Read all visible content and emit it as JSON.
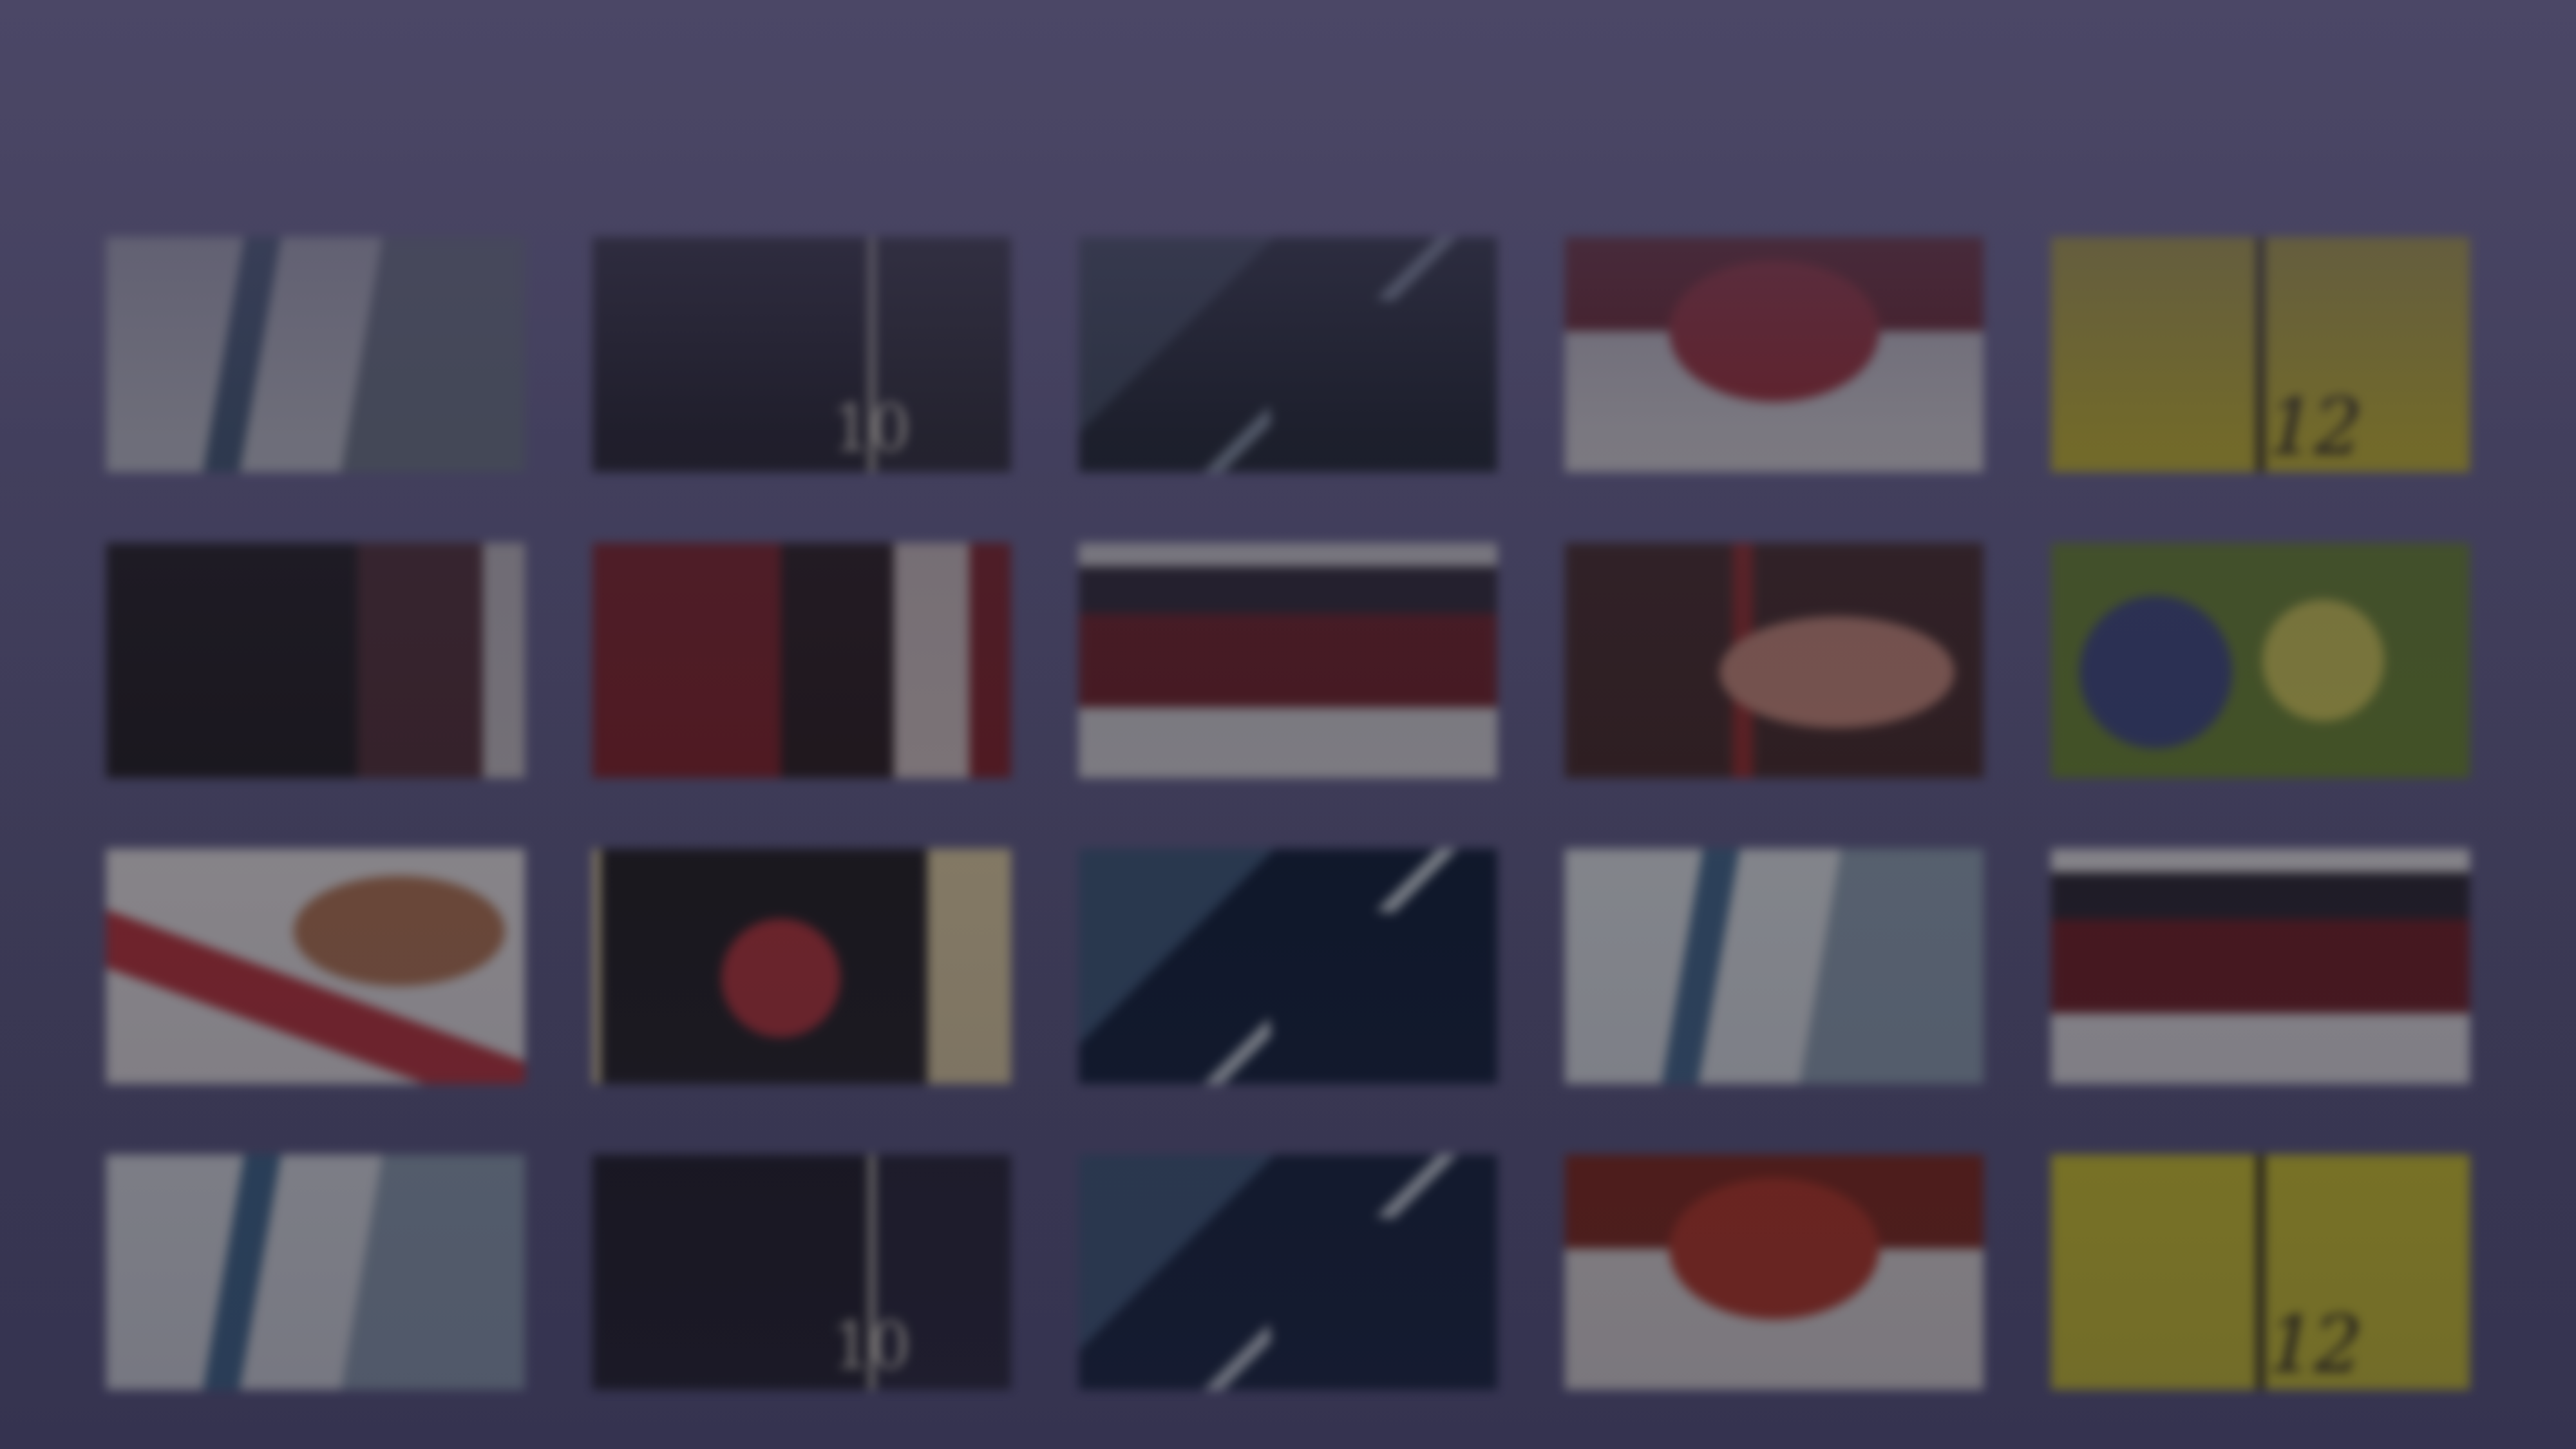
{
  "screen": {
    "title": "",
    "background": "#3b3953"
  },
  "grid": {
    "tiles": [
      {
        "theme": "racing-poster-blue",
        "colors": [
          "#6e7a8c",
          "#c9ccd6",
          "#3e5a7c"
        ],
        "label": ""
      },
      {
        "theme": "dark-poster-number",
        "colors": [
          "#22202e",
          "#2b2937",
          "#d9d3c4"
        ],
        "label": "10"
      },
      {
        "theme": "space-station-dark",
        "colors": [
          "#1a2230",
          "#3b4b60",
          "#8a9cb0"
        ],
        "label": ""
      },
      {
        "theme": "red-figure-poster",
        "colors": [
          "#b8242a",
          "#e5e1e3",
          "#7a1a1e"
        ],
        "label": ""
      },
      {
        "theme": "yellow-poster-number",
        "colors": [
          "#d4c21c",
          "#9e8e14",
          "#2a2418"
        ],
        "label": "12"
      },
      {
        "theme": "dark-red-portrait",
        "colors": [
          "#221d24",
          "#57303a",
          "#c9c2c8"
        ],
        "label": ""
      },
      {
        "theme": "red-collage",
        "colors": [
          "#8c1f28",
          "#2c1d22",
          "#d8c7c8"
        ],
        "label": ""
      },
      {
        "theme": "group-photo-banner",
        "colors": [
          "#d9d6dc",
          "#7a1f28",
          "#30283a"
        ],
        "label": ""
      },
      {
        "theme": "close-up-faces",
        "colors": [
          "#4a2a2a",
          "#d28a78",
          "#a02a2a"
        ],
        "label": ""
      },
      {
        "theme": "green-cartoon",
        "colors": [
          "#6b8a2a",
          "#3e4a8a",
          "#d7d04a"
        ],
        "label": ""
      },
      {
        "theme": "face-close-up-light",
        "colors": [
          "#e7e2e6",
          "#b87452",
          "#c8313c"
        ],
        "label": ""
      },
      {
        "theme": "red-nine-poster",
        "colors": [
          "#242028",
          "#c0323c",
          "#e2cfa0"
        ],
        "label": ""
      },
      {
        "theme": "space-station-blue",
        "colors": [
          "#102040",
          "#3c5a82",
          "#c8d2de"
        ],
        "label": ""
      },
      {
        "theme": "racing-poster-light",
        "colors": [
          "#8ea2b8",
          "#dfe3ea",
          "#416a96"
        ],
        "label": ""
      },
      {
        "theme": "group-photo-banner-2",
        "colors": [
          "#e3e0e6",
          "#7a1f28",
          "#2e2838"
        ],
        "label": ""
      },
      {
        "theme": "racing-poster-blue-2",
        "colors": [
          "#8ea2b8",
          "#e0e3ea",
          "#3a6894"
        ],
        "label": ""
      },
      {
        "theme": "dark-poster-number-2",
        "colors": [
          "#1e1c2a",
          "#26243a",
          "#e0dacb"
        ],
        "label": "10"
      },
      {
        "theme": "space-station-blue-2",
        "colors": [
          "#102040",
          "#3c5a82",
          "#c8d2de"
        ],
        "label": ""
      },
      {
        "theme": "red-figure-poster-2",
        "colors": [
          "#c8321e",
          "#e8e2e0",
          "#8c2416"
        ],
        "label": ""
      },
      {
        "theme": "yellow-poster-number-2",
        "colors": [
          "#d8cc1e",
          "#a8981a",
          "#2a2418"
        ],
        "label": "12"
      }
    ]
  }
}
